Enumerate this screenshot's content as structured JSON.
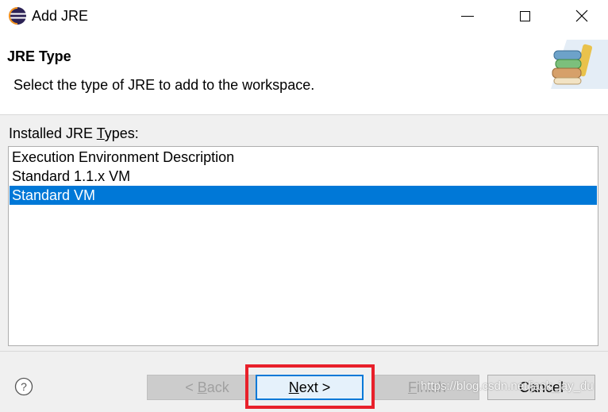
{
  "window": {
    "title": "Add JRE",
    "icon": "eclipse-icon"
  },
  "header": {
    "title": "JRE Type",
    "description": "Select the type of JRE to add to the workspace.",
    "icon": "books-icon"
  },
  "list": {
    "label_prefix": "Installed JRE ",
    "label_mnemonic": "T",
    "label_suffix": "ypes:",
    "items": [
      {
        "label": "Execution Environment Description",
        "selected": false
      },
      {
        "label": "Standard 1.1.x VM",
        "selected": false
      },
      {
        "label": "Standard VM",
        "selected": true
      }
    ]
  },
  "buttons": {
    "back": {
      "prefix": "< ",
      "mnemonic": "B",
      "suffix": "ack",
      "enabled": false
    },
    "next": {
      "mnemonic": "N",
      "suffix": "ext >",
      "enabled": true,
      "default": true
    },
    "finish": {
      "mnemonic": "F",
      "suffix": "inish",
      "enabled": false
    },
    "cancel": {
      "label": "Cancel",
      "enabled": true
    }
  },
  "help_icon": "help-icon",
  "watermark": "https://blog.csdn.net/jack_jay_du",
  "colors": {
    "selection": "#0078d7",
    "annotation": "#e8202a",
    "dialog_bg": "#f0f0f0"
  }
}
